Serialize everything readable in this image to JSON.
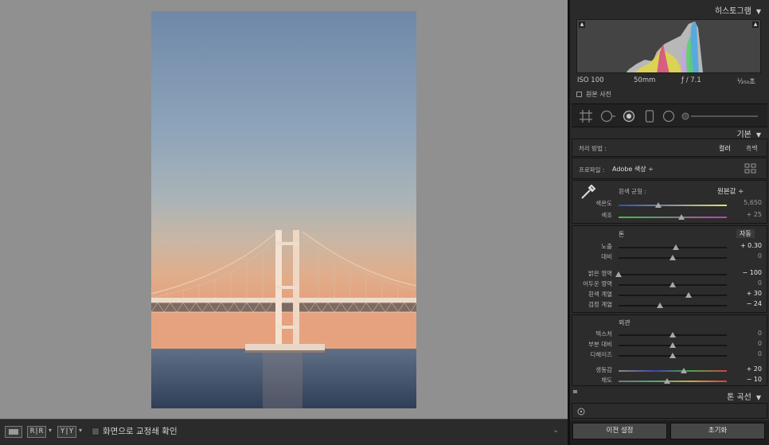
{
  "toolbar": {
    "view_loupe_icon": "loupe-view",
    "before_after_lr_label": "R|R",
    "before_after_yy_label": "Y|Y",
    "softproof_label": "화면으로 교정쇄 확인"
  },
  "histogram": {
    "title": "히스토그램",
    "iso": "ISO 100",
    "focal": "50mm",
    "aperture": "ƒ / 7.1",
    "shutter": "¹⁄₂₅₀초",
    "original_photo_label": "원본 사진"
  },
  "basic": {
    "title": "기본",
    "treatment_label": "처리 방법 :",
    "treatment_color": "컬러",
    "treatment_bw": "흑백",
    "profile_label": "프로파일 :",
    "profile_value": "Adobe 색상 ÷",
    "wb_label": "흰색 균형 :",
    "wb_value": "원본값 ÷",
    "temp_label": "색온도",
    "temp_value": "5,650",
    "temp_pos": 0.37,
    "tint_label": "색조",
    "tint_value": "+ 25",
    "tint_pos": 0.58,
    "tone_label": "톤",
    "auto_label": "자동",
    "exposure_label": "노출",
    "exposure_value": "+ 0.30",
    "exposure_pos": 0.53,
    "contrast_label": "대비",
    "contrast_value": "0",
    "contrast_pos": 0.5,
    "highlights_label": "밝은 영역",
    "highlights_value": "− 100",
    "highlights_pos": 0.0,
    "shadows_label": "어두운 영역",
    "shadows_value": "0",
    "shadows_pos": 0.5,
    "whites_label": "흰색 계열",
    "whites_value": "+ 30",
    "whites_pos": 0.65,
    "blacks_label": "검정 계열",
    "blacks_value": "− 24",
    "blacks_pos": 0.38,
    "presence_label": "외관",
    "texture_label": "텍스처",
    "texture_value": "0",
    "texture_pos": 0.5,
    "clarity_label": "부분 대비",
    "clarity_value": "0",
    "clarity_pos": 0.5,
    "dehaze_label": "디헤이즈",
    "dehaze_value": "0",
    "dehaze_pos": 0.5,
    "vibrance_label": "생동감",
    "vibrance_value": "+ 20",
    "vibrance_pos": 0.6,
    "saturation_label": "채도",
    "saturation_value": "− 10",
    "saturation_pos": 0.45
  },
  "tone_curve": {
    "title": "톤 곡선"
  },
  "bottom": {
    "previous_label": "이전 설정",
    "reset_label": "초기화"
  }
}
